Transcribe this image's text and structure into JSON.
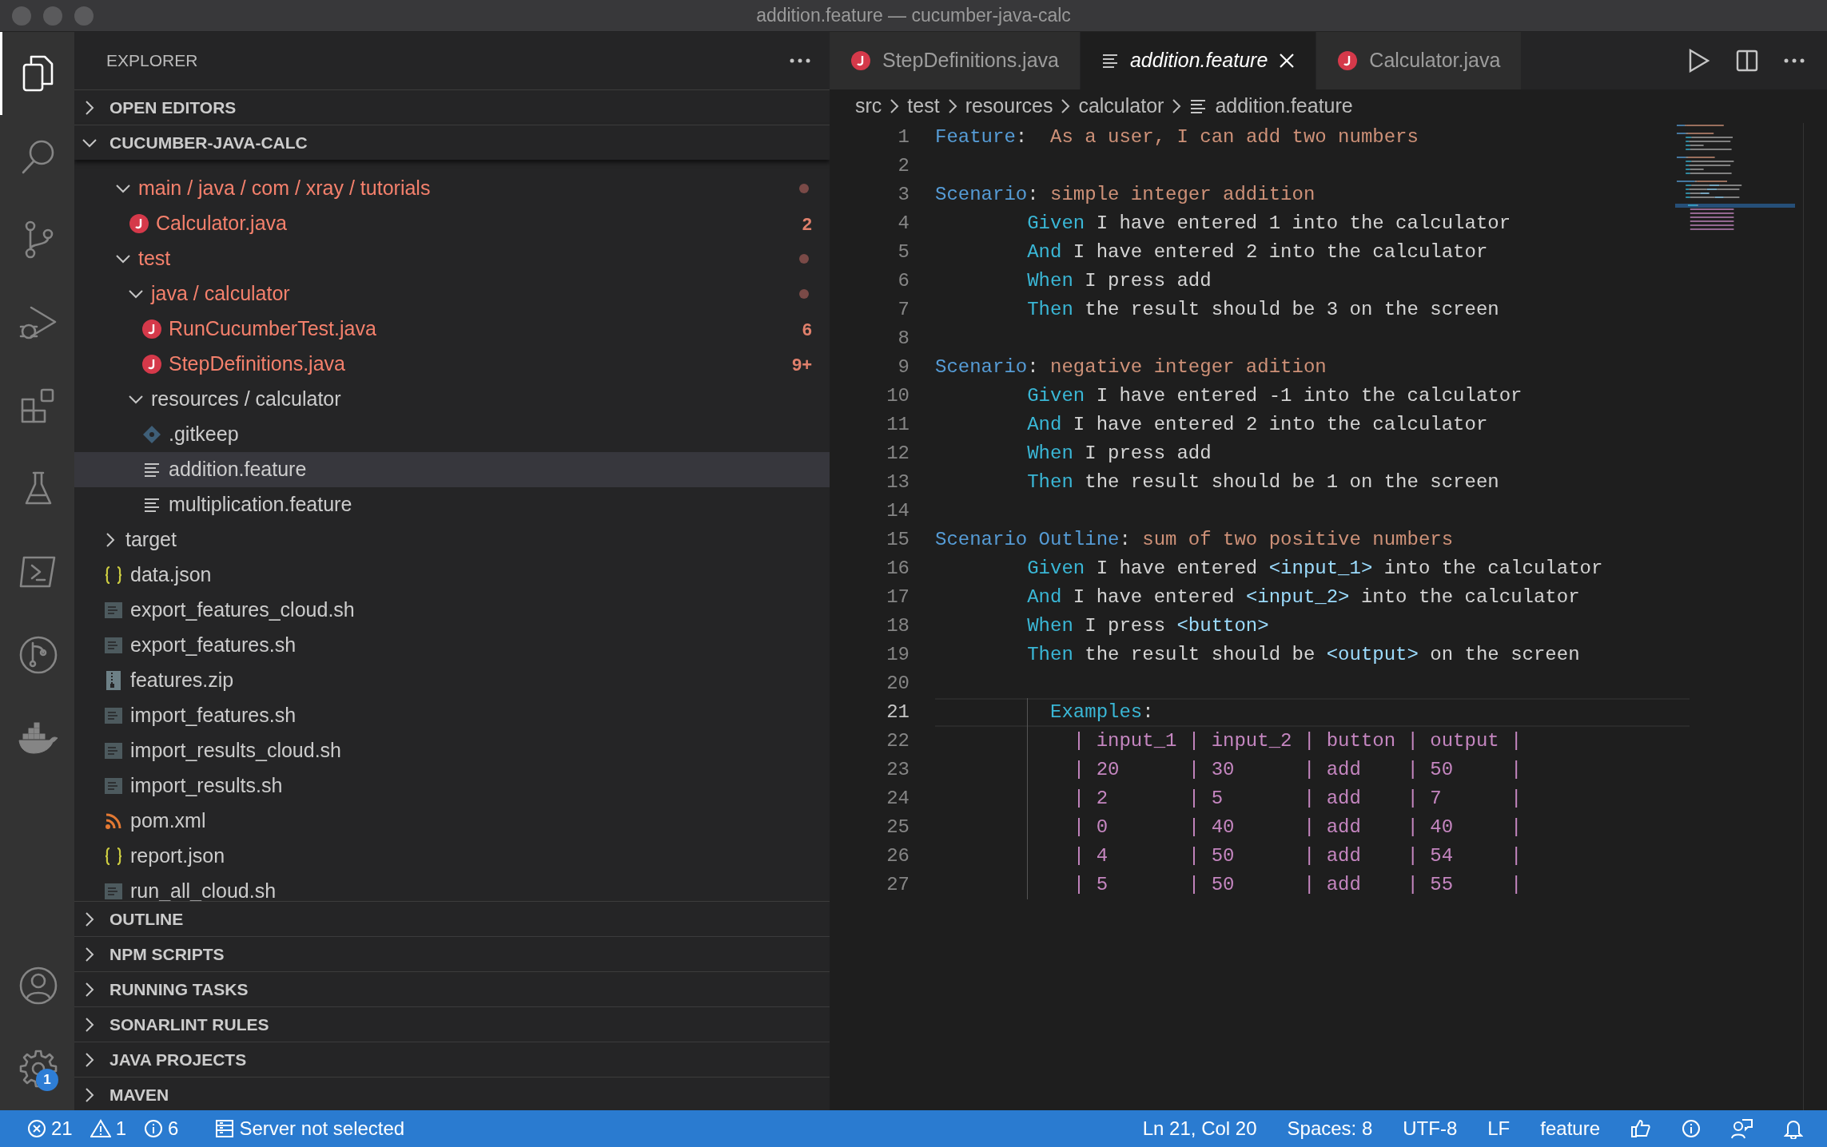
{
  "window": {
    "title": "addition.feature — cucumber-java-calc"
  },
  "activity_bar": {
    "top": [
      {
        "kind": "files",
        "selected": true
      },
      {
        "kind": "search",
        "selected": false
      },
      {
        "kind": "source-control",
        "selected": false
      },
      {
        "kind": "run-debug",
        "selected": false
      },
      {
        "kind": "extensions",
        "selected": false
      },
      {
        "kind": "flask",
        "selected": false
      },
      {
        "kind": "terminal",
        "selected": false
      },
      {
        "kind": "branch-circle",
        "selected": false
      },
      {
        "kind": "whale",
        "selected": false
      }
    ],
    "bottom": [
      {
        "kind": "account",
        "selected": false
      },
      {
        "kind": "settings",
        "selected": false,
        "badge": "1"
      }
    ]
  },
  "explorer": {
    "title": "EXPLORER",
    "sections_top": [
      {
        "label": "OPEN EDITORS",
        "expanded": false
      },
      {
        "label": "CUCUMBER-JAVA-CALC",
        "expanded": true
      }
    ],
    "tree": [
      {
        "kind": "hidden_parent",
        "children": [
          {
            "label": "main / java / com / xray / tutorials",
            "kind": "folder",
            "expanded": true,
            "error": true,
            "selected": false,
            "children": [
              {
                "label": "Calculator.java",
                "kind": "java",
                "error": true,
                "badge": "2",
                "selected": false
              }
            ]
          },
          {
            "label": "test",
            "kind": "folder",
            "expanded": true,
            "error": true,
            "selected": false,
            "children": [
              {
                "label": "java / calculator",
                "kind": "folder",
                "expanded": true,
                "error": true,
                "selected": false,
                "children": [
                  {
                    "label": "RunCucumberTest.java",
                    "kind": "java",
                    "error": true,
                    "badge": "6",
                    "selected": false
                  },
                  {
                    "label": "StepDefinitions.java",
                    "kind": "java",
                    "error": true,
                    "badge": "9+",
                    "selected": false
                  }
                ]
              },
              {
                "label": "resources / calculator",
                "kind": "folder",
                "expanded": true,
                "error": false,
                "selected": false,
                "children": [
                  {
                    "label": ".gitkeep",
                    "kind": "git",
                    "error": false,
                    "selected": false
                  },
                  {
                    "label": "addition.feature",
                    "kind": "feature",
                    "error": false,
                    "selected": true
                  },
                  {
                    "label": "multiplication.feature",
                    "kind": "feature",
                    "error": false,
                    "selected": false
                  }
                ]
              }
            ]
          }
        ]
      },
      {
        "label": "target",
        "kind": "folder",
        "expanded": false,
        "error": false,
        "selected": false
      },
      {
        "label": "data.json",
        "kind": "json",
        "error": false,
        "selected": false
      },
      {
        "label": "export_features_cloud.sh",
        "kind": "script",
        "error": false,
        "selected": false
      },
      {
        "label": "export_features.sh",
        "kind": "script",
        "error": false,
        "selected": false
      },
      {
        "label": "features.zip",
        "kind": "zip",
        "error": false,
        "selected": false
      },
      {
        "label": "import_features.sh",
        "kind": "script",
        "error": false,
        "selected": false
      },
      {
        "label": "import_results_cloud.sh",
        "kind": "script",
        "error": false,
        "selected": false
      },
      {
        "label": "import_results.sh",
        "kind": "script",
        "error": false,
        "selected": false
      },
      {
        "label": "pom.xml",
        "kind": "rss",
        "error": false,
        "selected": false
      },
      {
        "label": "report.json",
        "kind": "json",
        "error": false,
        "selected": false
      },
      {
        "label": "run_all_cloud.sh",
        "kind": "script",
        "error": false,
        "selected": false
      }
    ],
    "sections_bottom": [
      {
        "label": "OUTLINE",
        "expanded": false
      },
      {
        "label": "NPM SCRIPTS",
        "expanded": false
      },
      {
        "label": "RUNNING TASKS",
        "expanded": false
      },
      {
        "label": "SONARLINT RULES",
        "expanded": false
      },
      {
        "label": "JAVA PROJECTS",
        "expanded": false
      },
      {
        "label": "MAVEN",
        "expanded": false
      }
    ]
  },
  "tabs": [
    {
      "label": "StepDefinitions.java",
      "kind": "java",
      "selected": false,
      "preview": false
    },
    {
      "label": "addition.feature",
      "kind": "feature",
      "selected": true,
      "preview": true
    },
    {
      "label": "Calculator.java",
      "kind": "java",
      "selected": false,
      "preview": false
    }
  ],
  "breadcrumb": [
    {
      "label": "src",
      "kind": "text"
    },
    {
      "label": "test",
      "kind": "text"
    },
    {
      "label": "resources",
      "kind": "text"
    },
    {
      "label": "calculator",
      "kind": "text"
    },
    {
      "label": "addition.feature",
      "kind": "feature"
    }
  ],
  "lines": [
    {
      "n": "1",
      "kind": "top",
      "tokens": [
        {
          "text": "Feature",
          "kind": "keyword"
        },
        {
          "text": ":",
          "kind": "plain"
        },
        {
          "text": "  As a user, I can add two numbers",
          "kind": "title"
        }
      ]
    },
    {
      "n": "2",
      "kind": "blank"
    },
    {
      "n": "3",
      "kind": "top",
      "tokens": [
        {
          "text": "Scenario",
          "kind": "keyword"
        },
        {
          "text": ": ",
          "kind": "plain"
        },
        {
          "text": "simple integer addition",
          "kind": "title"
        }
      ]
    },
    {
      "n": "4",
      "kind": "step",
      "tokens": [
        {
          "text": "Given",
          "kind": "step"
        },
        {
          "text": " I have entered 1 into the calculator",
          "kind": "plain"
        }
      ]
    },
    {
      "n": "5",
      "kind": "step",
      "tokens": [
        {
          "text": "And",
          "kind": "step"
        },
        {
          "text": " I have entered 2 into the calculator",
          "kind": "plain"
        }
      ]
    },
    {
      "n": "6",
      "kind": "step",
      "tokens": [
        {
          "text": "When",
          "kind": "step"
        },
        {
          "text": " I press add",
          "kind": "plain"
        }
      ]
    },
    {
      "n": "7",
      "kind": "step",
      "tokens": [
        {
          "text": "Then",
          "kind": "step"
        },
        {
          "text": " the result should be 3 on the screen",
          "kind": "plain"
        }
      ]
    },
    {
      "n": "8",
      "kind": "blank"
    },
    {
      "n": "9",
      "kind": "top",
      "tokens": [
        {
          "text": "Scenario",
          "kind": "keyword"
        },
        {
          "text": ": ",
          "kind": "plain"
        },
        {
          "text": "negative integer adition",
          "kind": "title"
        }
      ]
    },
    {
      "n": "10",
      "kind": "step",
      "tokens": [
        {
          "text": "Given",
          "kind": "step"
        },
        {
          "text": " I have entered -1 into the calculator",
          "kind": "plain"
        }
      ]
    },
    {
      "n": "11",
      "kind": "step",
      "tokens": [
        {
          "text": "And",
          "kind": "step"
        },
        {
          "text": " I have entered 2 into the calculator",
          "kind": "plain"
        }
      ]
    },
    {
      "n": "12",
      "kind": "step",
      "tokens": [
        {
          "text": "When",
          "kind": "step"
        },
        {
          "text": " I press add",
          "kind": "plain"
        }
      ]
    },
    {
      "n": "13",
      "kind": "step",
      "tokens": [
        {
          "text": "Then",
          "kind": "step"
        },
        {
          "text": " the result should be 1 on the screen",
          "kind": "plain"
        }
      ]
    },
    {
      "n": "14",
      "kind": "blank"
    },
    {
      "n": "15",
      "kind": "top",
      "tokens": [
        {
          "text": "Scenario Outline",
          "kind": "keyword"
        },
        {
          "text": ": ",
          "kind": "plain"
        },
        {
          "text": "sum of two positive numbers",
          "kind": "title"
        }
      ]
    },
    {
      "n": "16",
      "kind": "step",
      "tokens": [
        {
          "text": "Given",
          "kind": "step"
        },
        {
          "text": " I have entered ",
          "kind": "plain"
        },
        {
          "text": "<input_1>",
          "kind": "placeholder"
        },
        {
          "text": " into the calculator",
          "kind": "plain"
        }
      ]
    },
    {
      "n": "17",
      "kind": "step",
      "tokens": [
        {
          "text": "And",
          "kind": "step"
        },
        {
          "text": " I have entered ",
          "kind": "plain"
        },
        {
          "text": "<input_2>",
          "kind": "placeholder"
        },
        {
          "text": " into the calculator",
          "kind": "plain"
        }
      ]
    },
    {
      "n": "18",
      "kind": "step",
      "tokens": [
        {
          "text": "When",
          "kind": "step"
        },
        {
          "text": " I press ",
          "kind": "plain"
        },
        {
          "text": "<button>",
          "kind": "placeholder"
        }
      ]
    },
    {
      "n": "19",
      "kind": "step",
      "tokens": [
        {
          "text": "Then",
          "kind": "step"
        },
        {
          "text": " the result should be ",
          "kind": "plain"
        },
        {
          "text": "<output>",
          "kind": "placeholder"
        },
        {
          "text": " on the screen",
          "kind": "plain"
        }
      ]
    },
    {
      "n": "20",
      "kind": "blank"
    },
    {
      "n": "21",
      "kind": "examples",
      "current": true,
      "tokens": [
        {
          "text": "Examples",
          "kind": "step"
        },
        {
          "text": ":",
          "kind": "plain"
        }
      ]
    },
    {
      "n": "22",
      "kind": "table",
      "tokens": [
        {
          "text": "| input_1 | input_2 | button | output |",
          "kind": "table"
        }
      ]
    },
    {
      "n": "23",
      "kind": "table",
      "tokens": [
        {
          "text": "| 20      | 30      | add    | 50     |",
          "kind": "table"
        }
      ]
    },
    {
      "n": "24",
      "kind": "table",
      "tokens": [
        {
          "text": "| 2       | 5       | add    | 7      |",
          "kind": "table"
        }
      ]
    },
    {
      "n": "25",
      "kind": "table",
      "tokens": [
        {
          "text": "| 0       | 40      | add    | 40     |",
          "kind": "table"
        }
      ]
    },
    {
      "n": "26",
      "kind": "table",
      "tokens": [
        {
          "text": "| 4       | 50      | add    | 54     |",
          "kind": "table"
        }
      ]
    },
    {
      "n": "27",
      "kind": "table",
      "tokens": [
        {
          "text": "| 5       | 50      | add    | 55     |",
          "kind": "table"
        }
      ]
    }
  ],
  "status_bar": {
    "left": [
      {
        "kind": "errors",
        "text": "21"
      },
      {
        "kind": "warnings",
        "text": "1"
      },
      {
        "kind": "info",
        "text": "6"
      },
      {
        "kind": "server",
        "text": "Server not selected"
      }
    ],
    "right": [
      {
        "kind": "text",
        "text": "Ln 21, Col 20"
      },
      {
        "kind": "text",
        "text": "Spaces: 8"
      },
      {
        "kind": "text",
        "text": "UTF-8"
      },
      {
        "kind": "text",
        "text": "LF"
      },
      {
        "kind": "text",
        "text": "feature"
      },
      {
        "kind": "thumbs-up"
      },
      {
        "kind": "info-circle"
      },
      {
        "kind": "person-chat"
      },
      {
        "kind": "bell"
      }
    ]
  }
}
